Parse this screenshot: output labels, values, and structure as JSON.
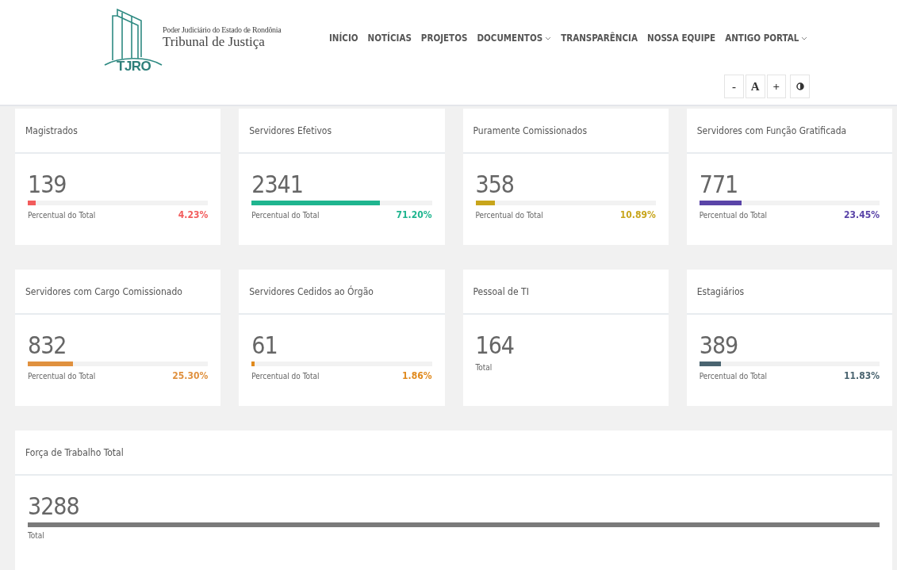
{
  "logo": {
    "badge": "TJRO",
    "subtitle": "Poder Judiciário do Estado de Rondônia",
    "title": "Tribunal de Justiça"
  },
  "nav": [
    {
      "label": "INÍCIO",
      "dropdown": false
    },
    {
      "label": "NOTÍCIAS",
      "dropdown": false
    },
    {
      "label": "PROJETOS",
      "dropdown": false
    },
    {
      "label": "DOCUMENTOS",
      "dropdown": true
    },
    {
      "label": "TRANSPARÊNCIA",
      "dropdown": false
    },
    {
      "label": "NOSSA EQUIPE",
      "dropdown": false
    },
    {
      "label": "ANTIGO PORTAL",
      "dropdown": true
    }
  ],
  "accessibility": [
    {
      "kind": "text",
      "label": "-"
    },
    {
      "kind": "text",
      "label": "A"
    },
    {
      "kind": "text",
      "label": "+"
    },
    {
      "kind": "contrast"
    }
  ],
  "cards": [
    {
      "kind": "bar",
      "title": "Magistrados",
      "value": "139",
      "caption": "Percentual do Total",
      "percent": "4.23%",
      "level": 0.0423,
      "color": "#f25c5c"
    },
    {
      "kind": "bar",
      "title": "Servidores Efetivos",
      "value": "2341",
      "caption": "Percentual do Total",
      "percent": "71.20%",
      "level": 0.712,
      "color": "#1fb58f"
    },
    {
      "kind": "bar",
      "title": "Puramente Comissionados",
      "value": "358",
      "caption": "Percentual do Total",
      "percent": "10.89%",
      "level": 0.1089,
      "color": "#c8a51b"
    },
    {
      "kind": "bar",
      "title": "Servidores com Função Gratificada",
      "value": "771",
      "caption": "Percentual do Total",
      "percent": "23.45%",
      "level": 0.2345,
      "color": "#5a44a8"
    },
    {
      "kind": "bar",
      "title": "Servidores com Cargo Comissionado",
      "value": "832",
      "caption": "Percentual do Total",
      "percent": "25.30%",
      "level": 0.253,
      "color": "#e0913f"
    },
    {
      "kind": "bar",
      "title": "Servidores Cedidos ao Órgão",
      "value": "61",
      "caption": "Percentual do Total",
      "percent": "1.86%",
      "level": 0.0186,
      "color": "#e08a1e"
    },
    {
      "kind": "plain",
      "title": "Pessoal de TI",
      "value": "164",
      "caption": "Total"
    },
    {
      "kind": "bar",
      "title": "Estagiários",
      "value": "389",
      "caption": "Percentual do Total",
      "percent": "11.83%",
      "level": 0.1183,
      "color": "#4a6470"
    }
  ],
  "total": {
    "title": "Força de Trabalho Total",
    "value": "3288",
    "caption": "Total",
    "level": 1,
    "color": "#7a7a7a"
  }
}
